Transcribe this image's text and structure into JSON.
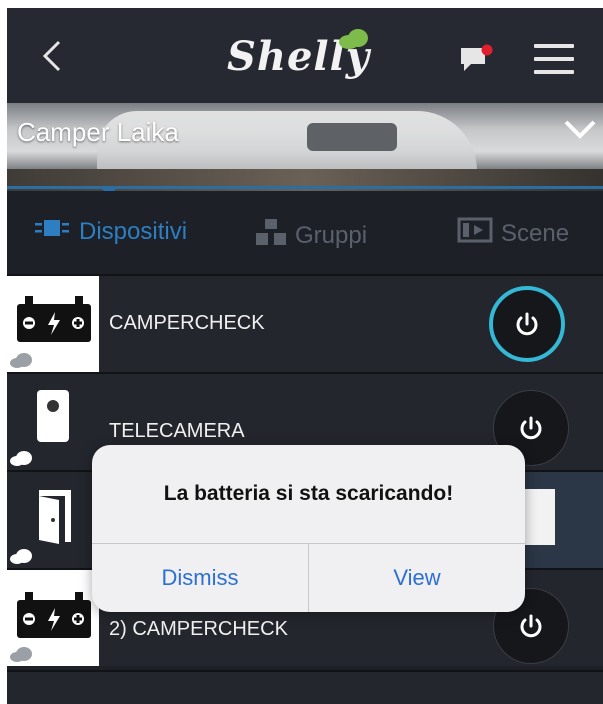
{
  "header": {
    "logo_text": "Shelly",
    "icons": [
      "back-icon",
      "chat-notification-icon",
      "hamburger-menu-icon"
    ]
  },
  "location": {
    "name": "Camper Laika"
  },
  "tabs": [
    {
      "label": "Dispositivi",
      "icon": "devices-icon",
      "active": true
    },
    {
      "label": "Gruppi",
      "icon": "groups-icon",
      "active": false
    },
    {
      "label": "Scene",
      "icon": "scenes-icon",
      "active": false
    }
  ],
  "devices": [
    {
      "name": "CAMPERCHECK",
      "icon": "battery-icon",
      "power_on": true
    },
    {
      "name": "TELECAMERA",
      "icon": "camera-icon",
      "power_on": false
    },
    {
      "name": "",
      "icon": "door-icon",
      "power_on": false
    },
    {
      "name": "2) CAMPERCHECK",
      "icon": "battery-icon",
      "power_on": false
    }
  ],
  "dialog": {
    "message": "La batteria si sta scaricando!",
    "dismiss_label": "Dismiss",
    "view_label": "View"
  },
  "colors": {
    "accent_blue": "#2d7fc2",
    "power_on_ring": "#35b7d6",
    "notification_dot": "#e02030",
    "dialog_button": "#2d6fd2"
  }
}
